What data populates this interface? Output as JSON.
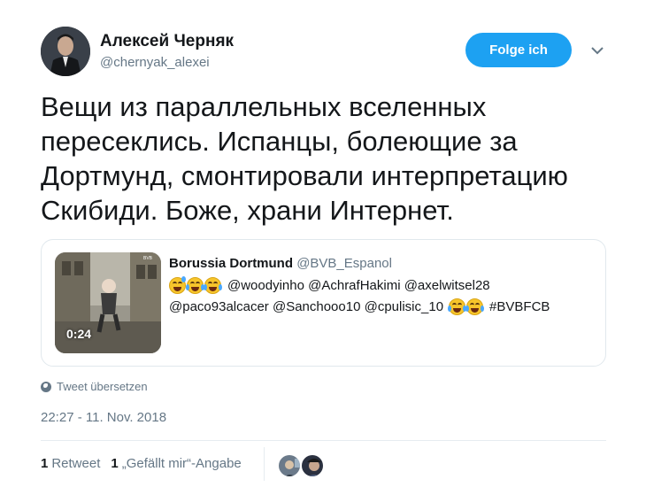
{
  "author": {
    "name": "Алексей Черняк",
    "handle": "@chernyak_alexei"
  },
  "follow_button": {
    "label": "Folge ich",
    "color": "#1da1f2"
  },
  "tweet_text": "Вещи из параллельных вселенных\nпересеклись. Испанцы, болеющие за\nДортмунд, смонтировали интерпретацию\nСкибиди. Боже, храни Интернет.",
  "quote": {
    "name": "Borussia Dortmund",
    "handle": "@BVB_Espanol",
    "line1_emojis": [
      "sweat-smile-emoji",
      "joy-emoji",
      "joy-emoji"
    ],
    "line1_text": "@woodyinho @AchrafHakimi @axelwitsel28",
    "line2_text": "@paco93alcacer @Sanchooo10 @cpulisic_10",
    "line2_emojis": [
      "joy-emoji",
      "joy-emoji"
    ],
    "line2_hashtag": "#BVBFCB",
    "video_duration": "0:24"
  },
  "translate_label": "Tweet übersetzen",
  "timestamp": "22:27 - 11. Nov. 2018",
  "stats": {
    "retweets_count": "1",
    "retweets_label": "Retweet",
    "likes_count": "1",
    "likes_label": "„Gefällt mir“-Angabe"
  },
  "colors": {
    "text_primary": "#14171a",
    "text_secondary": "#657786",
    "border": "#e1e8ed"
  }
}
